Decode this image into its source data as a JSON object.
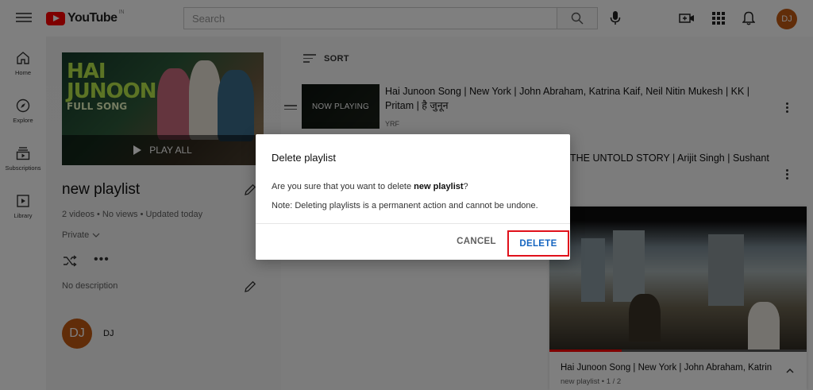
{
  "header": {
    "logo_text": "YouTube",
    "logo_region": "IN",
    "search_placeholder": "Search",
    "avatar_initials": "DJ"
  },
  "sidebar": {
    "items": [
      {
        "label": "Home",
        "icon": "home-icon"
      },
      {
        "label": "Explore",
        "icon": "compass-icon"
      },
      {
        "label": "Subscriptions",
        "icon": "subscriptions-icon"
      },
      {
        "label": "Library",
        "icon": "library-icon"
      }
    ]
  },
  "playlist": {
    "thumb_line1": "HAI",
    "thumb_line2": "JUNOON",
    "thumb_line3": "FULL SONG",
    "play_all_label": "PLAY ALL",
    "title": "new playlist",
    "meta": "2 videos • No views • Updated today",
    "privacy": "Private",
    "description": "No description",
    "owner_initials": "DJ",
    "owner_name": "DJ"
  },
  "list": {
    "sort_label": "SORT",
    "videos": [
      {
        "now_playing_label": "NOW PLAYING",
        "title": "Hai Junoon Song | New York | John Abraham, Katrina Kaif, Neil Nitin Mukesh | KK | Pritam | है जुनून",
        "channel": "YRF"
      },
      {
        "title": "THE UNTOLD STORY | Arijit Singh | Sushant"
      }
    ]
  },
  "miniplayer": {
    "title": "Hai Junoon Song | New York | John Abraham, Katrin",
    "subtitle": "new playlist • 1 / 2",
    "progress": 0.28
  },
  "dialog": {
    "title": "Delete playlist",
    "line1_prefix": "Are you sure that you want to delete ",
    "line1_bold": "new playlist",
    "line1_suffix": "?",
    "line2": "Note: Deleting playlists is a permanent action and cannot be undone.",
    "cancel_label": "CANCEL",
    "delete_label": "DELETE"
  },
  "colors": {
    "brand_red": "#ff0000",
    "link_blue": "#1565c0",
    "highlight_border": "#e0101b",
    "avatar": "#c35a13"
  }
}
